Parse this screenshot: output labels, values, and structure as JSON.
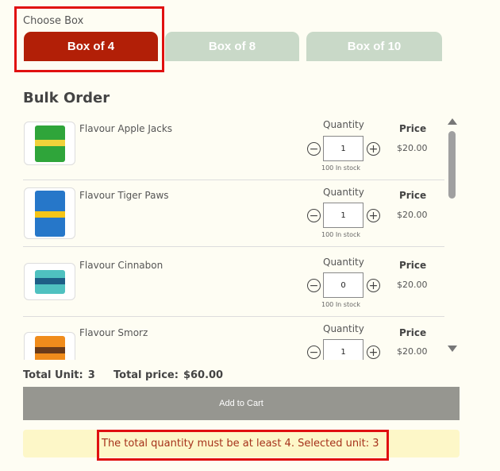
{
  "choose_box": {
    "label": "Choose Box",
    "tabs": [
      {
        "label": "Box of 4",
        "active": true
      },
      {
        "label": "Box of 8",
        "active": false
      },
      {
        "label": "Box of 10",
        "active": false
      }
    ]
  },
  "section_title": "Bulk Order",
  "columns": {
    "quantity": "Quantity",
    "price": "Price"
  },
  "products": [
    {
      "name": "Flavour Apple Jacks",
      "qty": "1",
      "stock": "100 In stock",
      "price": "$20.00",
      "pack_color": "#2fa53a",
      "band_color": "#f0d23a"
    },
    {
      "name": "Flavour Tiger Paws",
      "qty": "1",
      "stock": "100 In stock",
      "price": "$20.00",
      "pack_color": "#2677c9",
      "band_color": "#f5c518"
    },
    {
      "name": "Flavour Cinnabon",
      "qty": "0",
      "stock": "100 In stock",
      "price": "$20.00",
      "pack_color": "#4fc1c0",
      "band_color": "#1d5e86"
    },
    {
      "name": "Flavour Smorz",
      "qty": "1",
      "stock": "",
      "price": "$20.00",
      "pack_color": "#f08c1c",
      "band_color": "#6b3b1a"
    }
  ],
  "totals": {
    "unit_label": "Total Unit:",
    "unit_value": "3",
    "price_label": "Total price:",
    "price_value": "$60.00"
  },
  "add_to_cart": "Add to Cart",
  "alert": "The total quantity must be at least 4. Selected unit: 3",
  "colors": {
    "accent": "#b21f07",
    "inactive_tab": "#c9d9c8",
    "alert_bg": "#fdf7c8",
    "highlight": "#e01010"
  }
}
